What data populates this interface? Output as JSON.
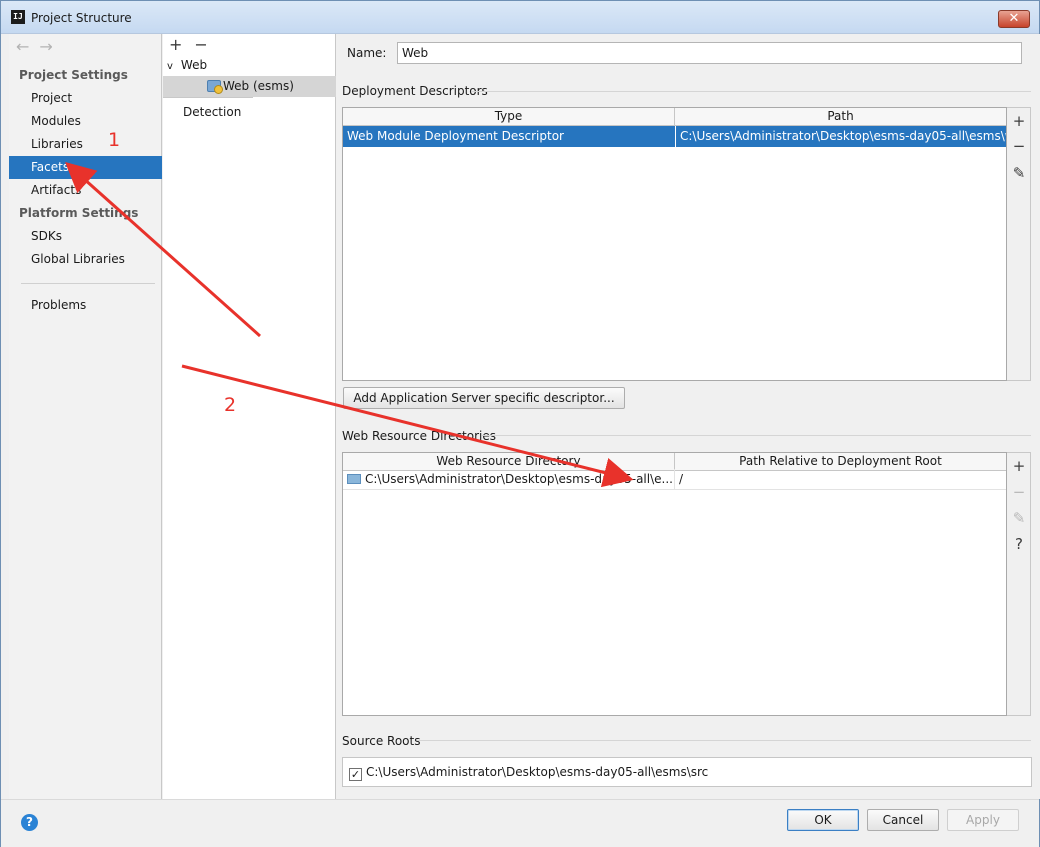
{
  "window": {
    "title": "Project Structure",
    "app_icon_text": "IJ",
    "close_glyph": "✕"
  },
  "nav": {
    "back_forward": "←→",
    "project_settings_header": "Project Settings",
    "items_project": [
      "Project",
      "Modules",
      "Libraries",
      "Facets",
      "Artifacts"
    ],
    "platform_settings_header": "Platform Settings",
    "items_platform": [
      "SDKs",
      "Global Libraries"
    ],
    "problems": "Problems",
    "selected": "Facets"
  },
  "tree": {
    "toolbar": "+−",
    "root": "Web",
    "child": "Web (esms)",
    "detection": "Detection"
  },
  "detail": {
    "name_label": "Name:",
    "name_value": "Web",
    "deployment_descriptors_header": "Deployment Descriptors",
    "dd_columns": [
      "Type",
      "Path"
    ],
    "dd_rows": [
      {
        "type": "Web Module Deployment Descriptor",
        "path": "C:\\Users\\Administrator\\Desktop\\esms-day05-all\\esms\\w"
      }
    ],
    "add_server_descriptor_button": "Add Application Server specific descriptor...",
    "web_resource_dirs_header": "Web Resource Directories",
    "wr_columns": [
      "Web Resource Directory",
      "Path Relative to Deployment Root"
    ],
    "wr_rows": [
      {
        "dir": "C:\\Users\\Administrator\\Desktop\\esms-day05-all\\e...",
        "relative": "/"
      }
    ],
    "source_roots_header": "Source Roots",
    "source_root_path": "C:\\Users\\Administrator\\Desktop\\esms-day05-all\\esms\\src",
    "source_root_checked": "✓"
  },
  "tools": {
    "add": "+",
    "remove": "−",
    "edit": "✎",
    "help": "?"
  },
  "footer": {
    "help_glyph": "?",
    "ok": "OK",
    "cancel": "Cancel",
    "apply": "Apply"
  },
  "annotations": {
    "marker_1": "1",
    "marker_2": "2",
    "color": "#e8322b"
  }
}
